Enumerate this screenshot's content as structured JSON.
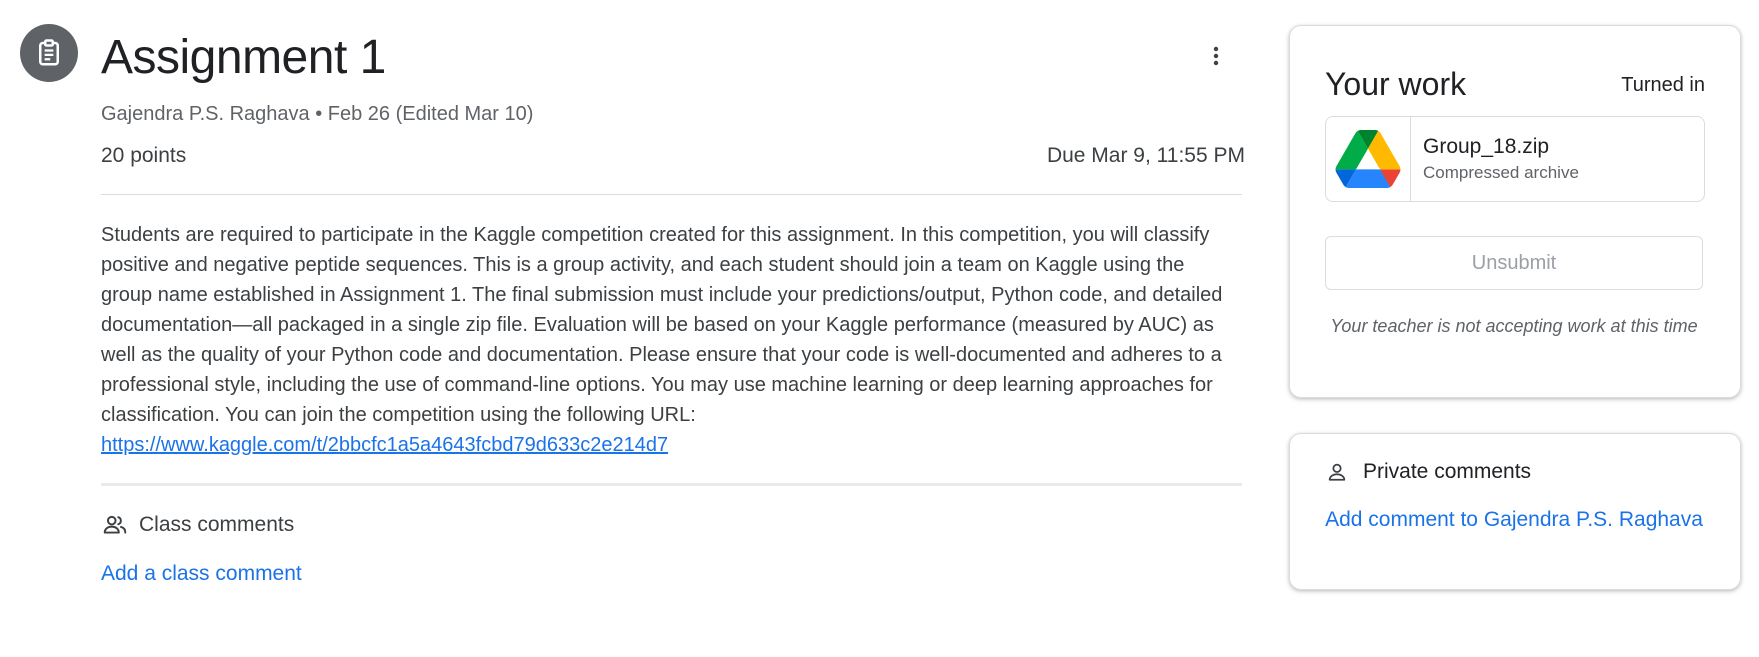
{
  "assignment": {
    "icon": "assignment-icon",
    "title": "Assignment 1",
    "meta": "Gajendra P.S. Raghava • Feb 26 (Edited Mar 10)",
    "points": "20 points",
    "due": "Due Mar 9, 11:55 PM",
    "description": "Students are required to participate in the Kaggle competition created for this assignment. In this competition, you will classify positive and negative peptide sequences. This is a group activity, and each student should join a team on Kaggle using the group name established in Assignment 1. The final submission must include your predictions/output, Python code, and detailed documentation—all packaged in a single zip file. Evaluation will be based on your Kaggle performance (measured by AUC) as well as the quality of your Python code and documentation. Please ensure that your code is well-documented and adheres to a professional style, including the use of command-line options. You may use machine learning or deep learning approaches for classification. You can join the competition using the following URL: ",
    "link": "https://www.kaggle.com/t/2bbcfc1a5a4643fcbd79d633c2e214d7"
  },
  "class_comments": {
    "icon": "people-icon",
    "label": "Class comments",
    "add_label": "Add a class comment"
  },
  "your_work": {
    "title": "Your work",
    "status": "Turned in",
    "attachment": {
      "icon": "google-drive-icon",
      "name": "Group_18.zip",
      "type": "Compressed archive"
    },
    "unsubmit_label": "Unsubmit",
    "notice": "Your teacher is not accepting work at this time"
  },
  "private_comments": {
    "icon": "person-icon",
    "label": "Private comments",
    "add_label": "Add comment to Gajendra P.S. Raghava"
  },
  "colors": {
    "accent": "#1a73e8",
    "icon_bg": "#5f6368"
  }
}
